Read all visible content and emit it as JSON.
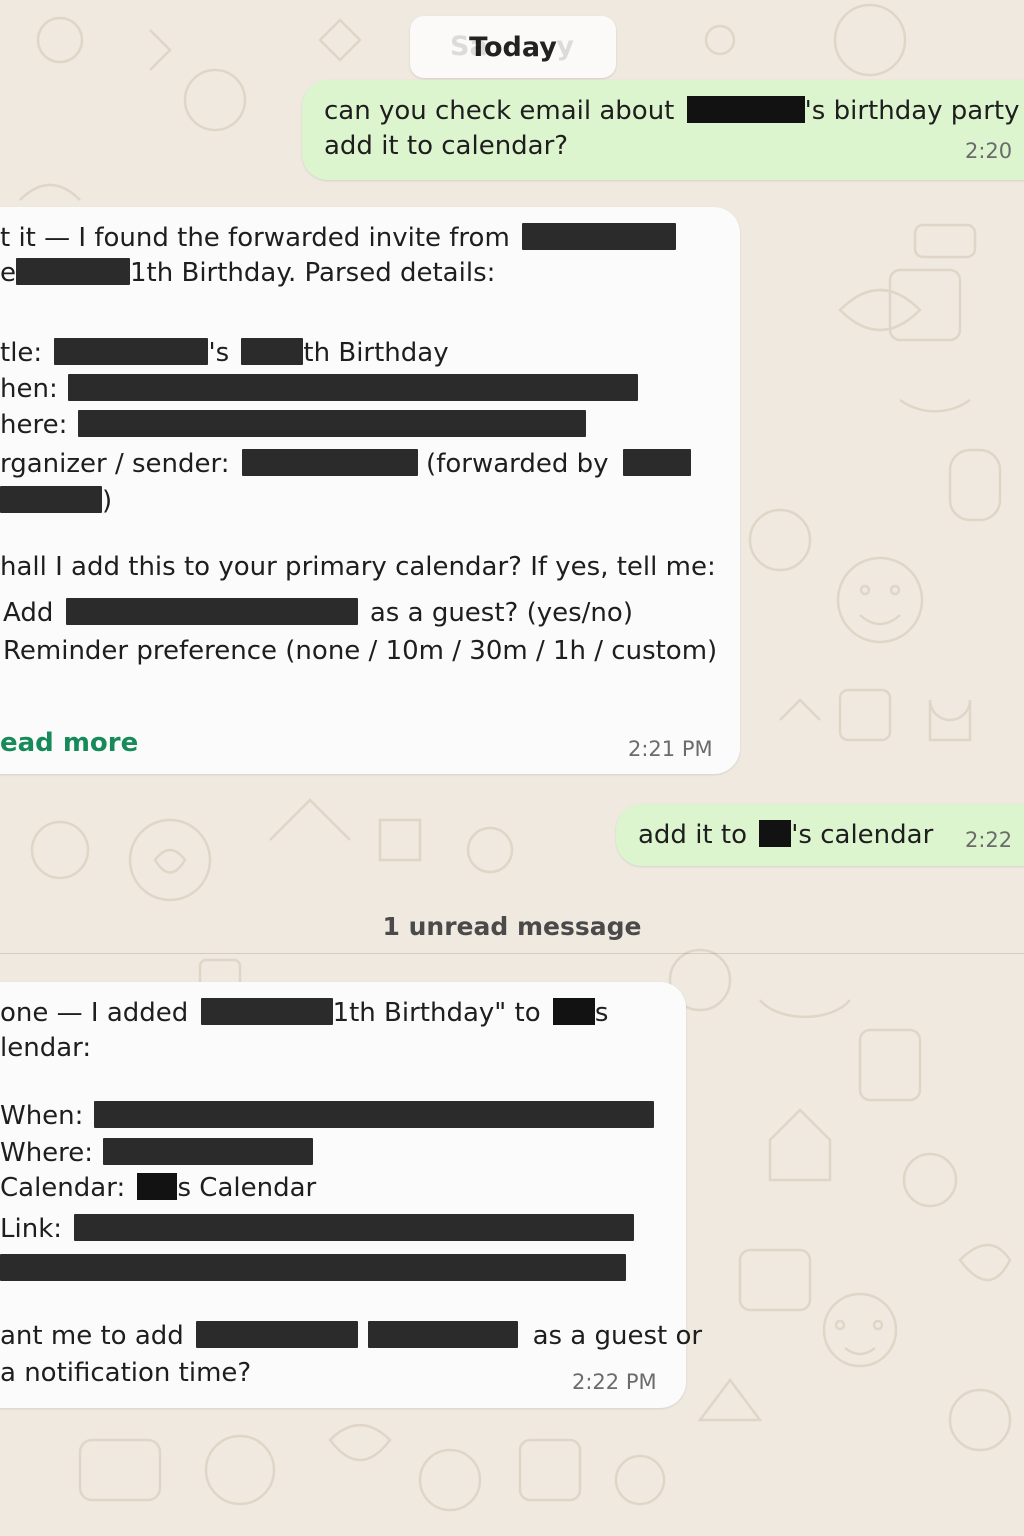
{
  "date_pill": {
    "label": "Today",
    "ghost_left": "Sa",
    "ghost_right": "y"
  },
  "messages": [
    {
      "line1_a": "can you check email about",
      "line1_b": "'s birthday party",
      "line2": "add it to calendar?",
      "time": "2:20"
    },
    {
      "line1": "t it — I found the forwarded invite from",
      "line2_a": "e",
      "line2_b": "1th Birthday. Parsed details:",
      "title_label": "tle:",
      "title_mid": "'s",
      "title_end": "th Birthday",
      "when_label": "hen:",
      "where_label": "here:",
      "organizer_label": "rganizer / sender:",
      "organizer_mid": "(forwarded by",
      "organizer_close": ")",
      "question": "hall I add this to your primary calendar? If yes, tell me:",
      "add_prefix": "Add",
      "add_suffix": "as a guest? (yes/no)",
      "reminder": "Reminder preference (none / 10m / 30m / 1h / custom)",
      "read_more": "ead more",
      "time": "2:21 PM"
    },
    {
      "text_a": "add it to",
      "text_b": "'s calendar",
      "time": "2:22"
    },
    {
      "line1_a": "one — I added",
      "line1_b": "1th Birthday\" to",
      "line1_c": "s",
      "line2": "lendar:",
      "when_label": "When:",
      "where_label": "Where:",
      "calendar_label": "Calendar:",
      "calendar_value": "s Calendar",
      "link_label": "Link:",
      "question_a": "ant me to add",
      "question_b": "as a guest or",
      "question_c": "a notification time?",
      "time": "2:22 PM"
    }
  ],
  "unread_divider": "1 unread message"
}
